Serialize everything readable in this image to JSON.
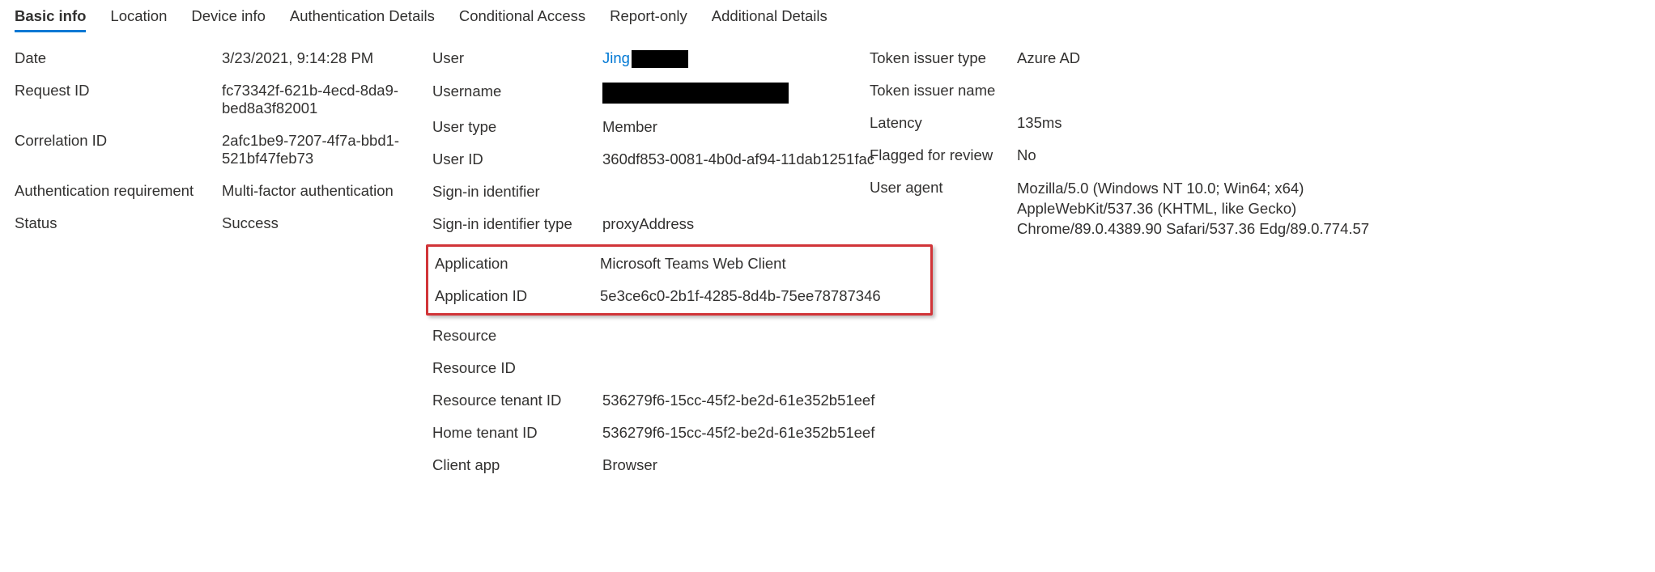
{
  "tabs": {
    "basic_info": "Basic info",
    "location": "Location",
    "device_info": "Device info",
    "auth_details": "Authentication Details",
    "cond_access": "Conditional Access",
    "report_only": "Report-only",
    "add_details": "Additional Details"
  },
  "col1": {
    "date_l": "Date",
    "date_v": "3/23/2021, 9:14:28 PM",
    "req_id_l": "Request ID",
    "req_id_v": "fc73342f-621b-4ecd-8da9-bed8a3f82001",
    "corr_id_l": "Correlation ID",
    "corr_id_v": "2afc1be9-7207-4f7a-bbd1-521bf47feb73",
    "auth_req_l": "Authentication requirement",
    "auth_req_v": "Multi-factor authentication",
    "status_l": "Status",
    "status_v": "Success"
  },
  "col2": {
    "user_l": "User",
    "user_v_link": "Jing",
    "username_l": "Username",
    "usertype_l": "User type",
    "usertype_v": "Member",
    "userid_l": "User ID",
    "userid_v": "360df853-0081-4b0d-af94-11dab1251fac",
    "signin_id_l": "Sign-in identifier",
    "signin_id_v": "",
    "signin_idt_l": "Sign-in identifier type",
    "signin_idt_v": "proxyAddress",
    "app_l": "Application",
    "app_v": "Microsoft Teams Web Client",
    "appid_l": "Application ID",
    "appid_v": "5e3ce6c0-2b1f-4285-8d4b-75ee78787346",
    "res_l": "Resource",
    "res_v": "",
    "resid_l": "Resource ID",
    "resid_v": "",
    "restid_l": "Resource tenant ID",
    "restid_v": "536279f6-15cc-45f2-be2d-61e352b51eef",
    "hometid_l": "Home tenant ID",
    "hometid_v": "536279f6-15cc-45f2-be2d-61e352b51eef",
    "clientapp_l": "Client app",
    "clientapp_v": "Browser"
  },
  "col3": {
    "tok_type_l": "Token issuer type",
    "tok_type_v": "Azure AD",
    "tok_name_l": "Token issuer name",
    "tok_name_v": "",
    "latency_l": "Latency",
    "latency_v": "135ms",
    "flagged_l": "Flagged for review",
    "flagged_v": "No",
    "ua_l": "User agent",
    "ua_v": "Mozilla/5.0 (Windows NT 10.0; Win64; x64) AppleWebKit/537.36 (KHTML, like Gecko) Chrome/89.0.4389.90 Safari/537.36 Edg/89.0.774.57"
  }
}
